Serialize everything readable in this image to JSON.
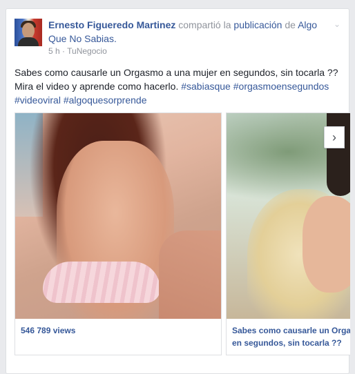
{
  "post": {
    "author": "Ernesto Figueredo Martinez",
    "action": "compartió la",
    "action_link": "publicación",
    "preposition": "de",
    "page": "Algo Que No Sabias.",
    "time": "5 h",
    "separator": "·",
    "source": "TuNegocio",
    "text": "Sabes como causarle un Orgasmo a una mujer en segundos, sin tocarla ?? Mira el video y aprende como hacerlo.",
    "hashtags": [
      "#sabiasque",
      "#orgasmoensegundos",
      "#videoviral",
      "#algoquesorprende"
    ]
  },
  "carousel": {
    "slides": [
      {
        "caption": "546 789 views"
      },
      {
        "caption": "Sabes como causarle un Orgasmo a una mujer en segundos, sin tocarla ??"
      }
    ],
    "next_icon": "chevron-right-icon",
    "next_glyph": "›"
  },
  "menu": {
    "icon": "chevron-down-icon",
    "glyph": "⌄"
  },
  "colors": {
    "link": "#365899",
    "muted": "#90949c",
    "text": "#1d2129",
    "background": "#e9eaed"
  }
}
